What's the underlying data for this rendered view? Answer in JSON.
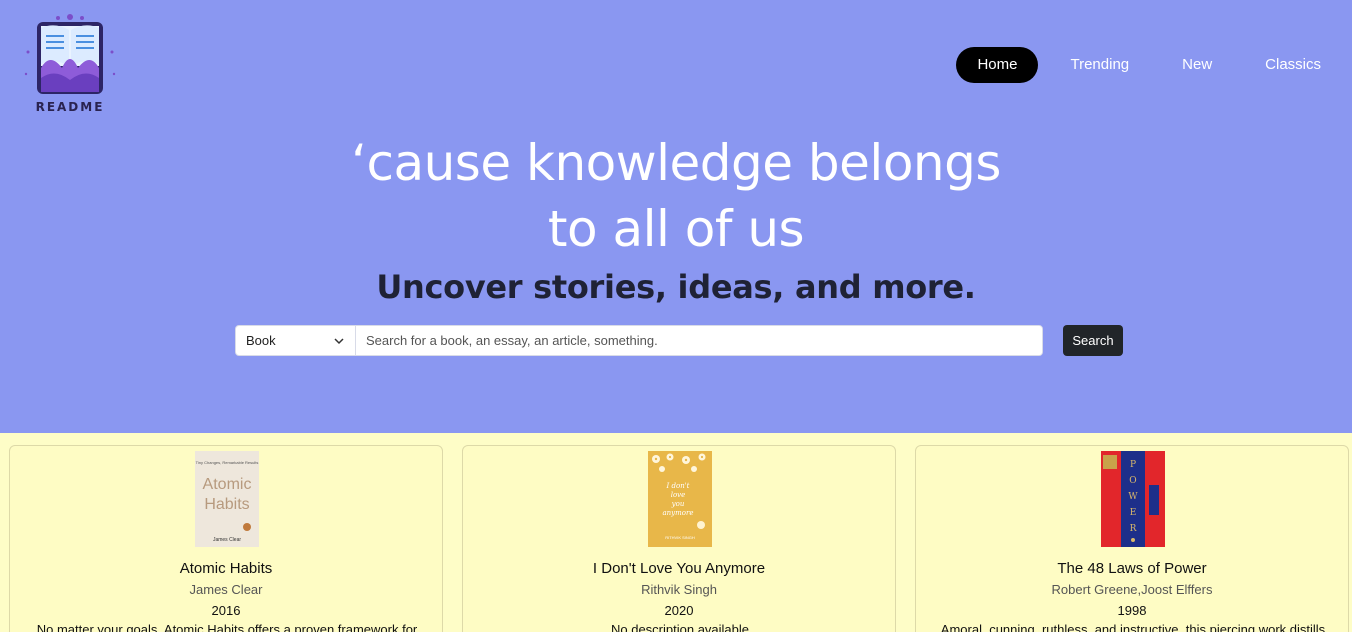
{
  "brand": {
    "name": "README"
  },
  "nav": {
    "items": [
      {
        "label": "Home",
        "active": true
      },
      {
        "label": "Trending",
        "active": false
      },
      {
        "label": "New",
        "active": false
      },
      {
        "label": "Classics",
        "active": false
      }
    ]
  },
  "hero": {
    "headline_line1": "‘cause knowledge belongs",
    "headline_line2": "to all of us",
    "subheadline": "Uncover stories, ideas, and more."
  },
  "search": {
    "type_selected": "Book",
    "placeholder": "Search for a book, an essay, an article, something.",
    "button_label": "Search"
  },
  "colors": {
    "hero_bg": "#8a97f1",
    "cards_bg": "#fefdc7",
    "active_nav_bg": "#000000",
    "search_button_bg": "#212529"
  },
  "books": [
    {
      "title": "Atomic Habits",
      "author": "James Clear",
      "year": "2016",
      "description": "No matter your goals, Atomic Habits offers a proven framework for",
      "cover_text": {
        "tag": "Tiny Changes, Remarkable Results",
        "title_line1": "Atomic",
        "title_line2": "Habits",
        "author": "James Clear"
      }
    },
    {
      "title": "I Don't Love You Anymore",
      "author": "Rithvik Singh",
      "year": "2020",
      "description": "No description available",
      "cover_text": {
        "title_line1": "I don't",
        "title_line2": "love",
        "title_line3": "you",
        "title_line4": "anymore",
        "author": "RITHVIK SINGH"
      }
    },
    {
      "title": "The 48 Laws of Power",
      "author": "Robert Greene,Joost Elffers",
      "year": "1998",
      "description": "Amoral, cunning, ruthless, and instructive, this piercing work distills",
      "cover_text": {
        "title": "POWER"
      }
    }
  ]
}
